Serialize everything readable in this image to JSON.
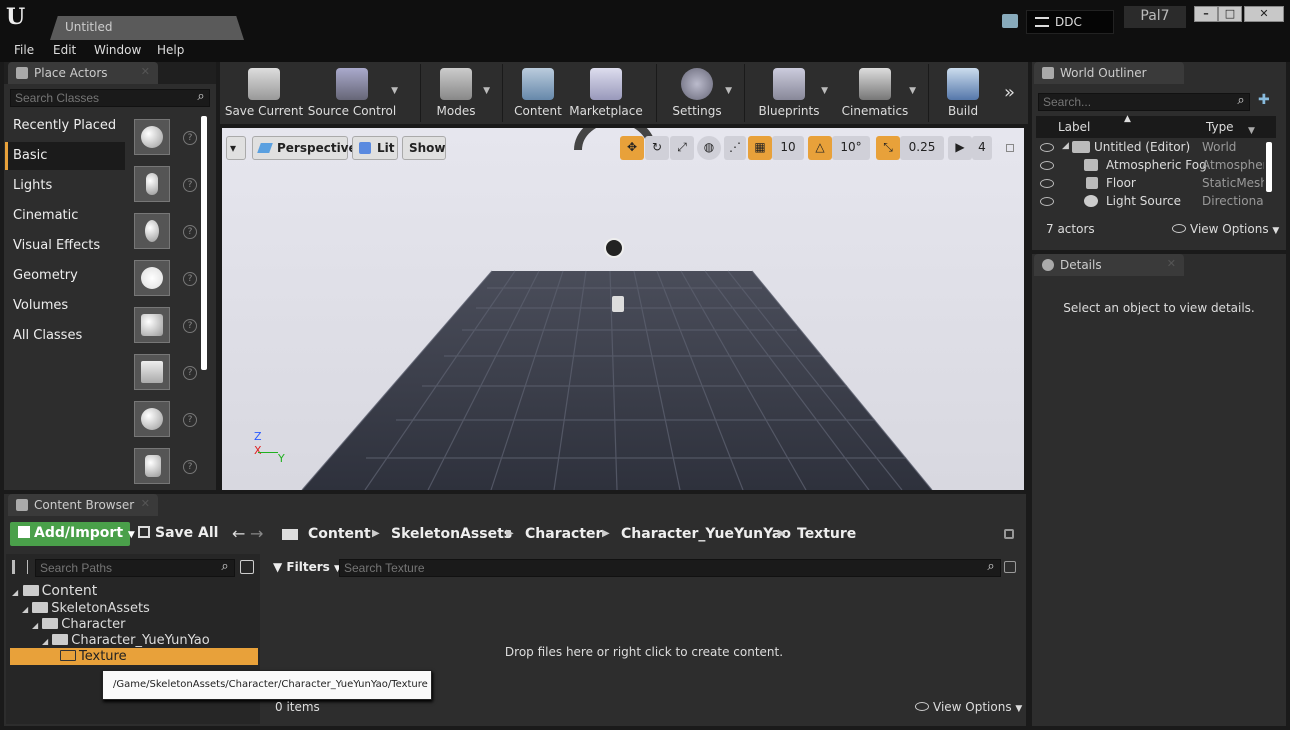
{
  "app": {
    "doc_tab": "Untitled",
    "ddc": "DDC",
    "user": "Pal7"
  },
  "window_buttons": {
    "minimize": "–",
    "maximize": "□",
    "close": "✕"
  },
  "menu": {
    "file": "File",
    "edit": "Edit",
    "window": "Window",
    "help": "Help"
  },
  "place_actors": {
    "tab": "Place Actors",
    "search_placeholder": "Search Classes",
    "categories": [
      "Recently Placed",
      "Basic",
      "Lights",
      "Cinematic",
      "Visual Effects",
      "Geometry",
      "Volumes",
      "All Classes"
    ],
    "selected": "Basic"
  },
  "toolbar": {
    "save_current": "Save Current",
    "source_control": "Source Control",
    "modes": "Modes",
    "content": "Content",
    "marketplace": "Marketplace",
    "settings": "Settings",
    "blueprints": "Blueprints",
    "cinematics": "Cinematics",
    "build": "Build"
  },
  "viewport": {
    "perspective": "Perspective",
    "lit": "Lit",
    "show": "Show",
    "grid_snap": "10",
    "rotation_snap": "10°",
    "scale_snap": "0.25",
    "camera_speed": "4",
    "axis_z": "Z",
    "axis_x": "X",
    "axis_y": "Y"
  },
  "outliner": {
    "tab": "World Outliner",
    "search_placeholder": "Search...",
    "col_label": "Label",
    "col_type": "Type",
    "rows": [
      {
        "label": "Untitled (Editor)",
        "type": "World"
      },
      {
        "label": "Atmospheric Fog",
        "type": "Atmospher"
      },
      {
        "label": "Floor",
        "type": "StaticMesh"
      },
      {
        "label": "Light Source",
        "type": "Directional"
      }
    ],
    "actor_count": "7 actors",
    "view_options": "View Options"
  },
  "details": {
    "tab": "Details",
    "empty": "Select an object to view details."
  },
  "content_browser": {
    "tab": "Content Browser",
    "add_import": "Add/Import",
    "save_all": "Save All",
    "breadcrumb": [
      "Content",
      "SkeletonAssets",
      "Character",
      "Character_YueYunYao",
      "Texture"
    ],
    "search_paths_placeholder": "Search Paths",
    "filters": "Filters",
    "search_texture_placeholder": "Search Texture",
    "tree": [
      "Content",
      "SkeletonAssets",
      "Character",
      "Character_YueYunYao",
      "Texture"
    ],
    "tooltip": "/Game/SkeletonAssets/Character/Character_YueYunYao/Texture",
    "drop_hint": "Drop files here or right click to create content.",
    "item_count": "0 items",
    "view_options": "View Options"
  },
  "colors": {
    "accent": "#e8a13a",
    "add_button": "#4aa04a",
    "panel": "#2d2d2d",
    "selection": "#e8a13a"
  }
}
